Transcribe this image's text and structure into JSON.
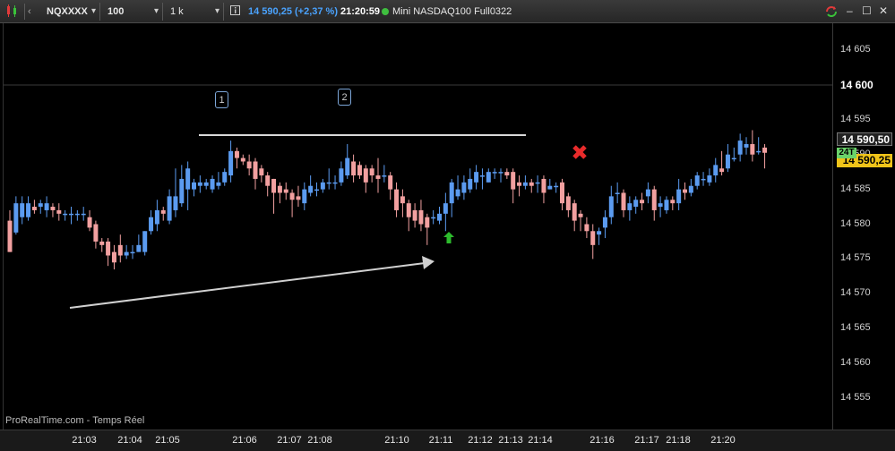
{
  "toolbar": {
    "instrument": "NQXXXX",
    "ticks": "100 ticks",
    "units": "1 k unités",
    "price": "14 590,25",
    "change": "(+2,37 %)",
    "time": "21:20:59",
    "contract": "Mini NASDAQ100 Full0322"
  },
  "watermark": "ProRealTime.com - Temps Réel",
  "yaxis": {
    "labels": [
      "14 605",
      "14 600",
      "14 595",
      "14 590",
      "14 585",
      "14 580",
      "14 575",
      "14 570",
      "14 565",
      "14 560",
      "14 555"
    ],
    "price_box_1": "14 590,50",
    "price_box_2": "14 590,25",
    "tag": "24T"
  },
  "xaxis": {
    "labels": [
      "21:03",
      "21:04",
      "21:05",
      "21:06",
      "21:07",
      "21:08",
      "21:10",
      "21:11",
      "21:12",
      "21:13",
      "21:14",
      "21:16",
      "21:17",
      "21:18",
      "21:20"
    ]
  },
  "annotations": {
    "label1": "1",
    "label2": "2"
  },
  "colors": {
    "up": "#5b9bf0",
    "down": "#f2a0a0",
    "background": "#000000",
    "accent_price": "#4aa3ff"
  },
  "chart_data": {
    "type": "candlestick",
    "ylim": [
      14553,
      14609
    ],
    "candles": [
      [
        14580.5,
        14576,
        14582,
        14576
      ],
      [
        14578.8,
        14583,
        14584,
        14578.5
      ],
      [
        14581,
        14583,
        14584,
        14580
      ],
      [
        14581,
        14583,
        14584,
        14580.5
      ],
      [
        14582.5,
        14582,
        14583.5,
        14581.5
      ],
      [
        14582.5,
        14583,
        14583.5,
        14581.5
      ],
      [
        14582,
        14583,
        14584,
        14581
      ],
      [
        14582.5,
        14582,
        14583,
        14581
      ],
      [
        14582,
        14581.5,
        14583,
        14580.5
      ],
      [
        14581.5,
        14581.5,
        14582,
        14580.5
      ],
      [
        14581.5,
        14581.5,
        14582.5,
        14580
      ],
      [
        14581.5,
        14581.5,
        14582,
        14580.5
      ],
      [
        14581.5,
        14581.5,
        14582.5,
        14580.5
      ],
      [
        14581,
        14579.5,
        14582,
        14579
      ],
      [
        14580,
        14577.5,
        14580.5,
        14576.5
      ],
      [
        14577.5,
        14577,
        14578,
        14576
      ],
      [
        14577.5,
        14575.5,
        14578,
        14574
      ],
      [
        14576,
        14574.5,
        14577,
        14573.5
      ],
      [
        14577,
        14575.5,
        14578.5,
        14574.5
      ],
      [
        14575.5,
        14576,
        14577,
        14575
      ],
      [
        14576,
        14576,
        14577,
        14575
      ],
      [
        14576,
        14577,
        14578.5,
        14576
      ],
      [
        14576,
        14579,
        14579,
        14575.5
      ],
      [
        14579,
        14581,
        14582,
        14578.5
      ],
      [
        14580,
        14582,
        14583.5,
        14579
      ],
      [
        14582,
        14581.5,
        14582.5,
        14580.5
      ],
      [
        14580.5,
        14584,
        14585,
        14580
      ],
      [
        14582,
        14584,
        14588,
        14581
      ],
      [
        14583,
        14586.5,
        14588.5,
        14582.5
      ],
      [
        14585,
        14588,
        14589,
        14582
      ],
      [
        14585,
        14586,
        14586.5,
        14584
      ],
      [
        14585.5,
        14586,
        14587,
        14584.5
      ],
      [
        14585.5,
        14586,
        14586.5,
        14585
      ],
      [
        14585,
        14586.5,
        14587,
        14584.5
      ],
      [
        14585.5,
        14586,
        14587.5,
        14585
      ],
      [
        14586,
        14587.5,
        14588,
        14585.5
      ],
      [
        14587,
        14590.5,
        14592,
        14586
      ],
      [
        14590.5,
        14589.5,
        14591,
        14588
      ],
      [
        14589.5,
        14589,
        14590,
        14588.5
      ],
      [
        14589,
        14588,
        14590,
        14587
      ],
      [
        14589,
        14586.5,
        14589.5,
        14585
      ],
      [
        14588,
        14587,
        14588.5,
        14586
      ],
      [
        14587,
        14585.5,
        14587.5,
        14584
      ],
      [
        14586.5,
        14584.5,
        14586.5,
        14581.5
      ],
      [
        14585.5,
        14584.5,
        14586,
        14583
      ],
      [
        14585,
        14584.5,
        14586,
        14583.5
      ],
      [
        14584.5,
        14583.5,
        14585,
        14581
      ],
      [
        14584,
        14583.5,
        14585.5,
        14582.5
      ],
      [
        14583,
        14585,
        14586,
        14582
      ],
      [
        14584.5,
        14585.5,
        14587,
        14584
      ],
      [
        14585,
        14585,
        14586,
        14584
      ],
      [
        14585,
        14586,
        14586.5,
        14584.5
      ],
      [
        14586,
        14586,
        14588,
        14585
      ],
      [
        14586,
        14586,
        14587,
        14585
      ],
      [
        14586,
        14588,
        14589,
        14585.5
      ],
      [
        14587,
        14589.5,
        14591.5,
        14586.5
      ],
      [
        14589,
        14587,
        14590,
        14586
      ],
      [
        14588.5,
        14587,
        14589,
        14586.5
      ],
      [
        14588,
        14586,
        14588.5,
        14584.5
      ],
      [
        14588,
        14587,
        14588.5,
        14586
      ],
      [
        14587,
        14586.5,
        14589.5,
        14584.5
      ],
      [
        14587,
        14587,
        14588.5,
        14586
      ],
      [
        14587,
        14585,
        14587.5,
        14583.5
      ],
      [
        14585,
        14582,
        14586,
        14581
      ],
      [
        14584,
        14583,
        14585,
        14581
      ],
      [
        14583,
        14581,
        14583.5,
        14579
      ],
      [
        14582,
        14580.5,
        14583,
        14579.5
      ],
      [
        14582,
        14580,
        14583.5,
        14579
      ],
      [
        14581,
        14579.5,
        14581.5,
        14577
      ],
      [
        14581,
        14581,
        14582,
        14580
      ],
      [
        14580.5,
        14581.5,
        14582.5,
        14580
      ],
      [
        14581.5,
        14583,
        14584.5,
        14579
      ],
      [
        14583,
        14586,
        14586.5,
        14581
      ],
      [
        14584,
        14585,
        14587,
        14583.5
      ],
      [
        14584.5,
        14586,
        14587,
        14583.5
      ],
      [
        14585,
        14586.5,
        14588,
        14584.5
      ],
      [
        14586,
        14587.5,
        14588.5,
        14585
      ],
      [
        14587,
        14587,
        14588,
        14585
      ],
      [
        14586,
        14587.5,
        14588,
        14586
      ],
      [
        14587.5,
        14587.5,
        14588,
        14586.5
      ],
      [
        14587.5,
        14587.5,
        14588,
        14586
      ],
      [
        14587.5,
        14587,
        14588,
        14586.5
      ],
      [
        14587.5,
        14585,
        14588,
        14583
      ],
      [
        14586,
        14585.5,
        14587,
        14584
      ],
      [
        14585.5,
        14586,
        14587,
        14585
      ],
      [
        14586,
        14585.5,
        14586.5,
        14584.5
      ],
      [
        14586,
        14586,
        14587,
        14584.5
      ],
      [
        14586.5,
        14584.5,
        14587,
        14583
      ],
      [
        14585,
        14585.5,
        14586.5,
        14585
      ],
      [
        14585.5,
        14585.5,
        14586,
        14584.5
      ],
      [
        14586,
        14583,
        14586.5,
        14582
      ],
      [
        14584,
        14582,
        14584.5,
        14581
      ],
      [
        14583,
        14580.5,
        14583.5,
        14579
      ],
      [
        14581.5,
        14581,
        14582,
        14579
      ],
      [
        14580,
        14579,
        14581,
        14578
      ],
      [
        14579,
        14577,
        14580,
        14575
      ],
      [
        14578.5,
        14579,
        14579.5,
        14577
      ],
      [
        14579.5,
        14581,
        14582,
        14578
      ],
      [
        14581,
        14584,
        14585.5,
        14580
      ],
      [
        14584.5,
        14584.5,
        14586,
        14583
      ],
      [
        14584.5,
        14582,
        14585,
        14581
      ],
      [
        14582,
        14583,
        14584,
        14580.5
      ],
      [
        14582.5,
        14583.5,
        14584,
        14581.5
      ],
      [
        14583.5,
        14583,
        14584.5,
        14582
      ],
      [
        14584,
        14585,
        14586,
        14583
      ],
      [
        14585,
        14582,
        14585.5,
        14580.5
      ],
      [
        14582.5,
        14583,
        14584,
        14581
      ],
      [
        14582,
        14583.5,
        14584,
        14581.5
      ],
      [
        14583.5,
        14583,
        14584,
        14582
      ],
      [
        14583,
        14585,
        14586.5,
        14582
      ],
      [
        14585,
        14584.5,
        14586,
        14583.5
      ],
      [
        14584.5,
        14585.5,
        14586.5,
        14584
      ],
      [
        14585.5,
        14587,
        14587.5,
        14585
      ],
      [
        14586.5,
        14586.5,
        14587.5,
        14585.5
      ],
      [
        14586,
        14587,
        14588,
        14585.5
      ],
      [
        14587,
        14588.5,
        14589.5,
        14586
      ],
      [
        14588,
        14587.5,
        14590.5,
        14587
      ],
      [
        14588,
        14590,
        14591.5,
        14587.5
      ],
      [
        14589.5,
        14589.5,
        14591,
        14589
      ],
      [
        14590,
        14592,
        14593,
        14589
      ],
      [
        14591,
        14591.5,
        14592.5,
        14590
      ],
      [
        14591.5,
        14590,
        14593.5,
        14589
      ],
      [
        14590.5,
        14590.5,
        14592.5,
        14590
      ],
      [
        14591,
        14590.25,
        14591.5,
        14588
      ]
    ]
  }
}
